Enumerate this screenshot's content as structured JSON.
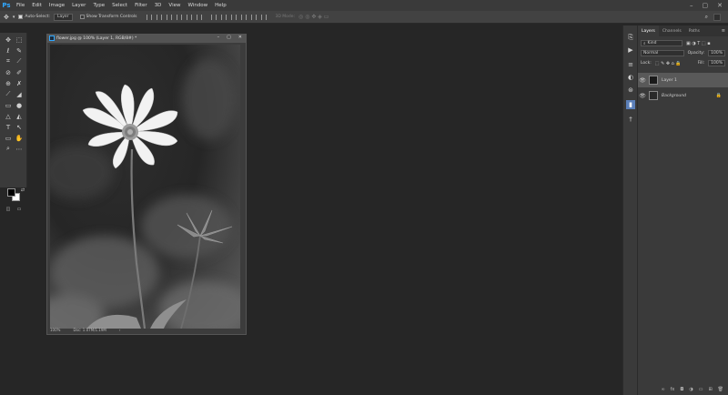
{
  "app": {
    "logo": "Ps"
  },
  "menu": [
    "File",
    "Edit",
    "Image",
    "Layer",
    "Type",
    "Select",
    "Filter",
    "3D",
    "View",
    "Window",
    "Help"
  ],
  "window_controls": [
    "–",
    "▢",
    "✕"
  ],
  "options": {
    "auto_select": "Auto-Select:",
    "auto_select_value": "Layer",
    "show_transform": "Show Transform Controls",
    "mode_3d": "3D Mode:"
  },
  "document": {
    "title": "flower.jpg @ 100% (Layer 1, RGB/8#) *",
    "zoom": "100%",
    "doc_size": "Doc: 1.07M/1.19M",
    "controls": [
      "–",
      "▢",
      "✕"
    ]
  },
  "layers_panel": {
    "tabs": [
      "Layers",
      "Channels",
      "Paths"
    ],
    "filter_kind": "Kind",
    "blend_mode": "Normal",
    "opacity_label": "Opacity:",
    "opacity_value": "100%",
    "lock_label": "Lock:",
    "fill_label": "Fill:",
    "fill_value": "100%",
    "layers": [
      {
        "name": "Layer 1",
        "selected": true
      },
      {
        "name": "Background",
        "selected": false,
        "locked": true
      }
    ]
  },
  "colors": {
    "accent": "#31a8ff",
    "foreground": "#000000",
    "background": "#ffffff",
    "selected_layer": "#595959"
  }
}
